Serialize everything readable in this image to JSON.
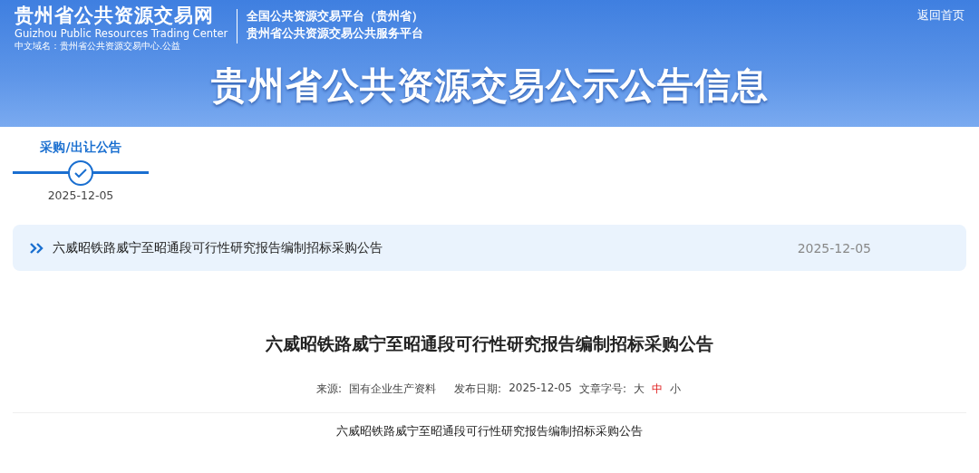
{
  "header": {
    "site_name": "贵州省公共资源交易网",
    "site_name_en": "Guizhou Public Resources Trading Center",
    "domain": "中文域名：贵州省公共资源交易中心.公益",
    "platform_lines": [
      "全国公共资源交易平台（贵州省）",
      "贵州省公共资源交易公共服务平台"
    ],
    "home_link": "返回首页",
    "banner_title": "贵州省公共资源交易公示公告信息"
  },
  "steps": [
    {
      "label": "采购/出让公告",
      "date": "2025-12-05",
      "done": true
    }
  ],
  "notice": {
    "title": "六威昭铁路威宁至昭通段可行性研究报告编制招标采购公告",
    "date": "2025-12-05"
  },
  "article": {
    "title": "六威昭铁路威宁至昭通段可行性研究报告编制招标采购公告",
    "source_label": "来源:",
    "source": "国有企业生产资料",
    "date_label": "发布日期:",
    "date": "2025-12-05",
    "size_label": "文章字号:",
    "font_sizes": [
      {
        "label": "大",
        "selected": false
      },
      {
        "label": "中",
        "selected": true
      },
      {
        "label": "小",
        "selected": false
      }
    ],
    "body": "六威昭铁路威宁至昭通段可行性研究报告编制招标采购公告"
  }
}
